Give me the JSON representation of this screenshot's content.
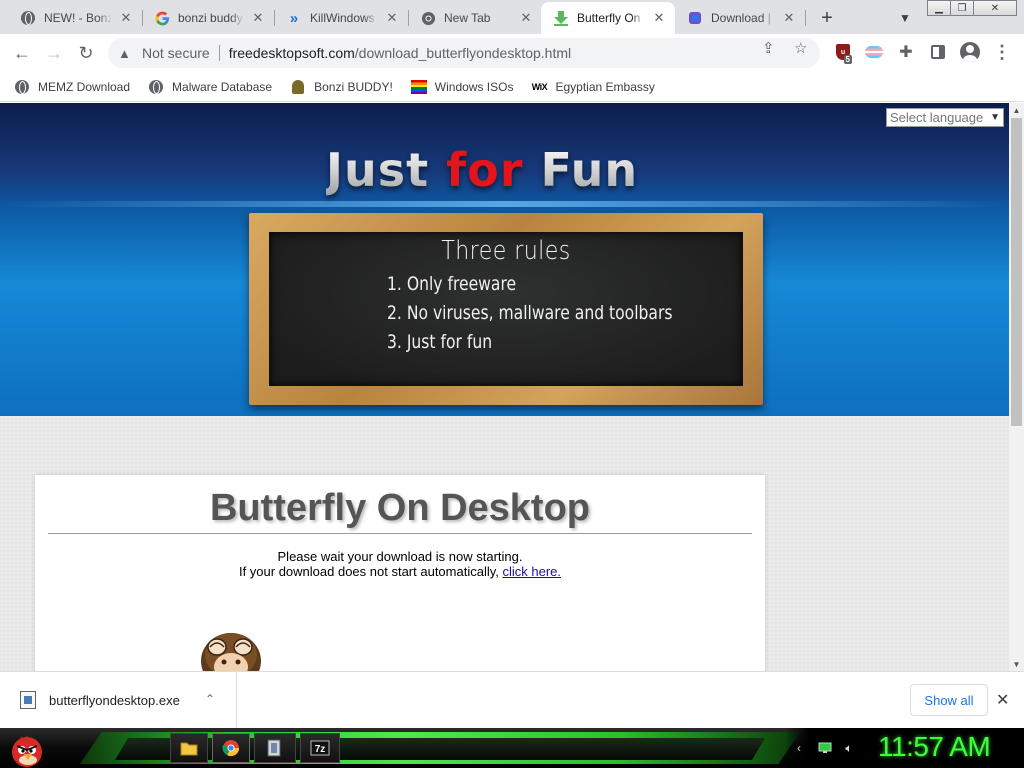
{
  "tabs": [
    {
      "title": "NEW! - Bonzi",
      "icon": "globe-icon",
      "active": false
    },
    {
      "title": "bonzi buddy",
      "icon": "google-icon",
      "active": false
    },
    {
      "title": "KillWindows",
      "icon": "chevron-logo-icon",
      "active": false
    },
    {
      "title": "New Tab",
      "icon": "chrome-icon",
      "active": false
    },
    {
      "title": "Butterfly On",
      "icon": "download-arrow-icon",
      "active": true
    },
    {
      "title": "Download | f",
      "icon": "site-logo-icon",
      "active": false
    }
  ],
  "toolbar": {
    "security_label": "Not secure",
    "url_host": "freedesktopsoft.com",
    "url_path": "/download_butterflyondesktop.html",
    "extension_badge": "5"
  },
  "bookmarks": [
    {
      "label": "MEMZ Download",
      "icon": "globe-icon"
    },
    {
      "label": "Malware Database",
      "icon": "globe-icon"
    },
    {
      "label": "Bonzi BUDDY!",
      "icon": "bonzi-icon"
    },
    {
      "label": "Windows ISOs",
      "icon": "rainbow-flag-icon"
    },
    {
      "label": "Egyptian Embassy",
      "icon": "wix-icon"
    }
  ],
  "page": {
    "language_select": "Select language",
    "site_title": {
      "part1": "Just",
      "part2": "for",
      "part3": "Fun"
    },
    "board": {
      "title": "Three rules",
      "rules": [
        "1. Only freeware",
        "2. No viruses, mallware and toolbars",
        "3. Just for fun"
      ]
    },
    "product_title": "Butterfly On Desktop",
    "message_line1": "Please wait your download is now starting.",
    "message_line2": "If your download does not start automatically,",
    "message_link": "click here."
  },
  "downloads": {
    "filename": "butterflyondesktop.exe",
    "show_all": "Show all"
  },
  "taskbar": {
    "clock": "11:57 AM"
  },
  "colors": {
    "active_tab_bg": "#ffffff",
    "tabstrip_bg": "#dfe1e5",
    "link": "#1a0dab",
    "title_red": "#e3141b",
    "clock_green": "#3cff3c"
  }
}
